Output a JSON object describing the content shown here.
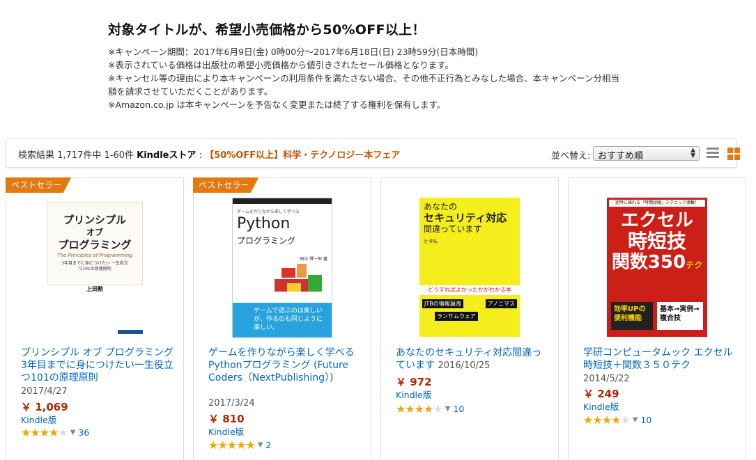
{
  "promo": {
    "headline": "対象タイトルが、希望小売価格から50%OFF以上！",
    "lines": [
      "※キャンペーン期間：2017年6月9日(金) 0時00分〜2017年6月18日(日) 23時59分(日本時間)",
      "※表示されている価格は出版社の希望小売価格から値引きされたセール価格となります。",
      "※キャンセル等の理由により本キャンペーンの利用条件を満たさない場合、その他不正行為とみなした場合、本キャンペーン分相当",
      "額を請求させていただくことがあります。",
      "※Amazon.co.jp は本キャンペーンを予告なく変更または終了する権利を保有します。"
    ]
  },
  "results": {
    "count_text": "検索結果 1,717件中 1-60件 ",
    "store": "Kindleストア",
    "separator": " : ",
    "fair": "【50%OFF以上】科学・テクノロジー本フェア",
    "sort_label": "並べ替え:",
    "sort_value": "おすすめ順"
  },
  "products": [
    {
      "badge": "ベストセラー",
      "title": "プリンシプル オブ プログラミング 3年目までに身につけたい一生役立つ101の原理原則",
      "date": "2017/4/27",
      "price": "￥ 1,069",
      "format": "Kindle版",
      "stars": "★★★★",
      "half": "★",
      "review_count": "36",
      "cover": {
        "line1": "プリンシプル",
        "line2": "オブ",
        "line3": "プログラミング",
        "en": "The Principles of Programming",
        "sub": "3年目までに身につけたい 一生役立つ101の原理原則",
        "author": "上田勲"
      }
    },
    {
      "badge": "ベストセラー",
      "title": "ゲームを作りながら楽しく学べるPythonプログラミング (Future Coders（NextPublishing）)",
      "date": "2017/3/24",
      "price": "￥ 810",
      "format": "Kindle版",
      "stars": "★★★★★",
      "half": "",
      "review_count": "2",
      "cover": {
        "top": "ゲームを作りながら楽しく学べる",
        "main": "Python",
        "sub": "プログラミング",
        "author": "田中 賢一郎 著",
        "note": "ゲームで遊ぶのは楽しいが、作るのも同じように楽しい。"
      }
    },
    {
      "badge": "",
      "title": "あなたのセキュリティ対応間違っています",
      "date": "2016/10/25",
      "price": "￥ 972",
      "format": "Kindle版",
      "stars": "★★★★",
      "half": "★",
      "review_count": "10",
      "cover": {
        "line1": "あなたの",
        "line2": "セキュリティ対応",
        "line3": "間違っています",
        "author": "辻 伸弘",
        "banner": "どうすればよかったかがわかる本",
        "tag": "JTBの情報漏洩",
        "tag2": "アノニマス",
        "tag3": "ランサムウェア"
      }
    },
    {
      "badge": "",
      "title": "学研コンピュータムック エクセル時短技＋関数３５０テク",
      "date": "2014/5/22",
      "price": "￥ 249",
      "format": "Kindle版",
      "stars": "★★★★",
      "half": "★",
      "review_count": "10",
      "cover": {
        "top": "定時に帰れる「時間短縮」テクニック満載！",
        "line1": "エクセル",
        "line2": "時短技",
        "line3": "関数350",
        "unit": "テク",
        "box": "効率UPの便利機能",
        "side": "基本→実例→複合技"
      }
    }
  ]
}
